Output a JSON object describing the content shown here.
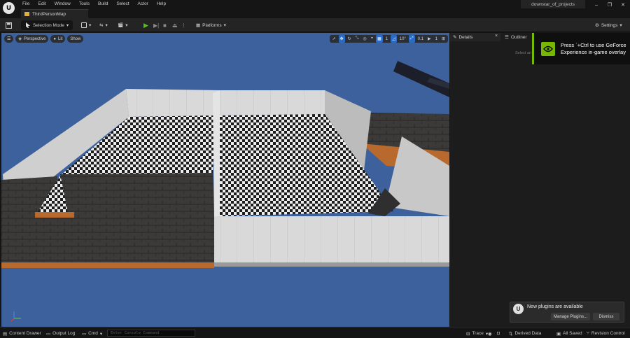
{
  "app": {
    "logo_letter": "U"
  },
  "menu": [
    "File",
    "Edit",
    "Window",
    "Tools",
    "Build",
    "Select",
    "Actor",
    "Help"
  ],
  "map_tab": {
    "label": "ThirdPersonMap"
  },
  "project_name": "downstar_of_projects",
  "window_controls": {
    "minimize": "–",
    "maximize": "❐",
    "close": "✕"
  },
  "toolbar": {
    "selection_mode": "Selection Mode",
    "platforms": "Platforms",
    "settings": "Settings"
  },
  "viewport": {
    "perspective": "Perspective",
    "lit": "Lit",
    "show": "Show",
    "grid_snap": "1",
    "rotation_snap": "10°",
    "scale_snap": "0.1",
    "camera_speed": "1",
    "sky_color": "#3d619c"
  },
  "panels": {
    "details": "Details",
    "outliner": "Outliner",
    "select_actor_hint": "Select an"
  },
  "geforce": {
    "message": "Press `+Ctrl to use GeForce Experience in-game overlay",
    "accent": "#76b900"
  },
  "plugins_notice": {
    "title": "New plugins are available",
    "manage": "Manage Plugins...",
    "dismiss": "Dismiss"
  },
  "statusbar": {
    "content_drawer": "Content Drawer",
    "output_log": "Output Log",
    "cmd": "Cmd",
    "console_placeholder": "Enter Console Command",
    "trace": "Trace",
    "derived_data": "Derived Data",
    "all_saved": "All Saved",
    "revision_control": "Revision Control"
  }
}
